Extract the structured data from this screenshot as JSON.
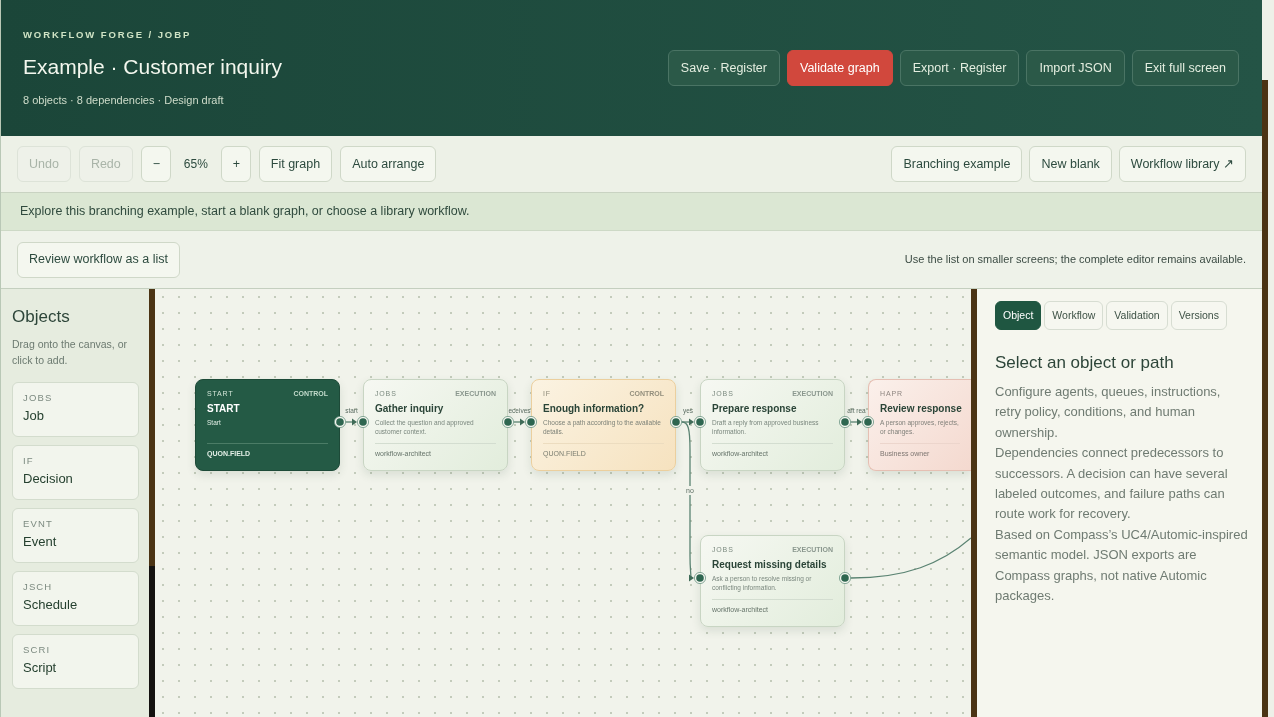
{
  "header": {
    "breadcrumb": "WORKFLOW FORGE / JOBP",
    "title": "Example · Customer inquiry",
    "subtitle": "8 objects · 8 dependencies · Design draft",
    "buttons": [
      {
        "label": "Save · Register",
        "kind": "ghost"
      },
      {
        "label": "Validate graph",
        "kind": "accent"
      },
      {
        "label": "Export · Register",
        "kind": "ghost"
      },
      {
        "label": "Import JSON",
        "kind": "ghost"
      },
      {
        "label": "Exit full screen",
        "kind": "ghost"
      }
    ]
  },
  "toolbar": {
    "history": [
      {
        "label": "Undo",
        "disabled": true
      },
      {
        "label": "Redo",
        "disabled": true
      }
    ],
    "zoom": {
      "out": "−",
      "level": "65%",
      "in": "+"
    },
    "actions": [
      "Fit graph",
      "Auto arrange"
    ],
    "right": [
      "Branching example",
      "New blank",
      "Workflow library ↗"
    ]
  },
  "banner": "Explore this branching example, start a blank graph, or choose a library workflow.",
  "list_bar": {
    "button": "Review workflow as a list",
    "note": "Use the list on smaller screens; the complete editor remains available."
  },
  "sidebar": {
    "title": "Objects",
    "hint": "Drag onto the canvas, or click to add.",
    "items": [
      {
        "code": "JOBS",
        "name": "Job"
      },
      {
        "code": "IF",
        "name": "Decision"
      },
      {
        "code": "EVNT",
        "name": "Event"
      },
      {
        "code": "JSCH",
        "name": "Schedule"
      },
      {
        "code": "SCRI",
        "name": "Script"
      }
    ]
  },
  "canvas": {
    "nodes": [
      {
        "kind": "start",
        "type": "START",
        "category": "CONTROL",
        "title": "START",
        "description": "Start",
        "footer": "QUON.FIELD"
      },
      {
        "kind": "job",
        "type": "JOBS",
        "category": "EXECUTION",
        "title": "Gather inquiry",
        "description": "Collect the question and approved customer context.",
        "footer": "workflow-architect"
      },
      {
        "kind": "decision",
        "type": "IF",
        "category": "CONTROL",
        "title": "Enough information?",
        "description": "Choose a path according to the available details.",
        "footer": "QUON.FIELD"
      },
      {
        "kind": "job",
        "type": "JOBS",
        "category": "EXECUTION",
        "title": "Prepare response",
        "description": "Draft a reply from approved business information.",
        "footer": "workflow-architect"
      },
      {
        "kind": "approval",
        "type": "HAPR",
        "title": "Review response",
        "description": "A person approves, rejects, or changes.",
        "footer": "Business owner"
      },
      {
        "kind": "job",
        "type": "JOBS",
        "category": "EXECUTION",
        "title": "Request missing details",
        "description": "Ask a person to resolve missing or conflicting information.",
        "footer": "workflow-architect"
      }
    ],
    "edges": [
      {
        "label": "start"
      },
      {
        "label": "eceives"
      },
      {
        "label": "yes"
      },
      {
        "label": "no"
      },
      {
        "label": "aft rea"
      }
    ]
  },
  "inspector": {
    "tabs": [
      {
        "label": "Object",
        "selected": true
      },
      {
        "label": "Workflow",
        "selected": false
      },
      {
        "label": "Validation",
        "selected": false
      },
      {
        "label": "Versions",
        "selected": false
      }
    ],
    "title": "Select an object or path",
    "paragraphs": [
      "Configure agents, queues, instructions, retry policy, conditions, and human ownership.",
      "Dependencies connect predecessors to successors. A decision can have several labeled outcomes, and failure paths can route work for recovery.",
      "Based on Compass’s UC4/Automic-inspired semantic model. JSON exports are Compass graphs, not native Automic packages."
    ]
  }
}
